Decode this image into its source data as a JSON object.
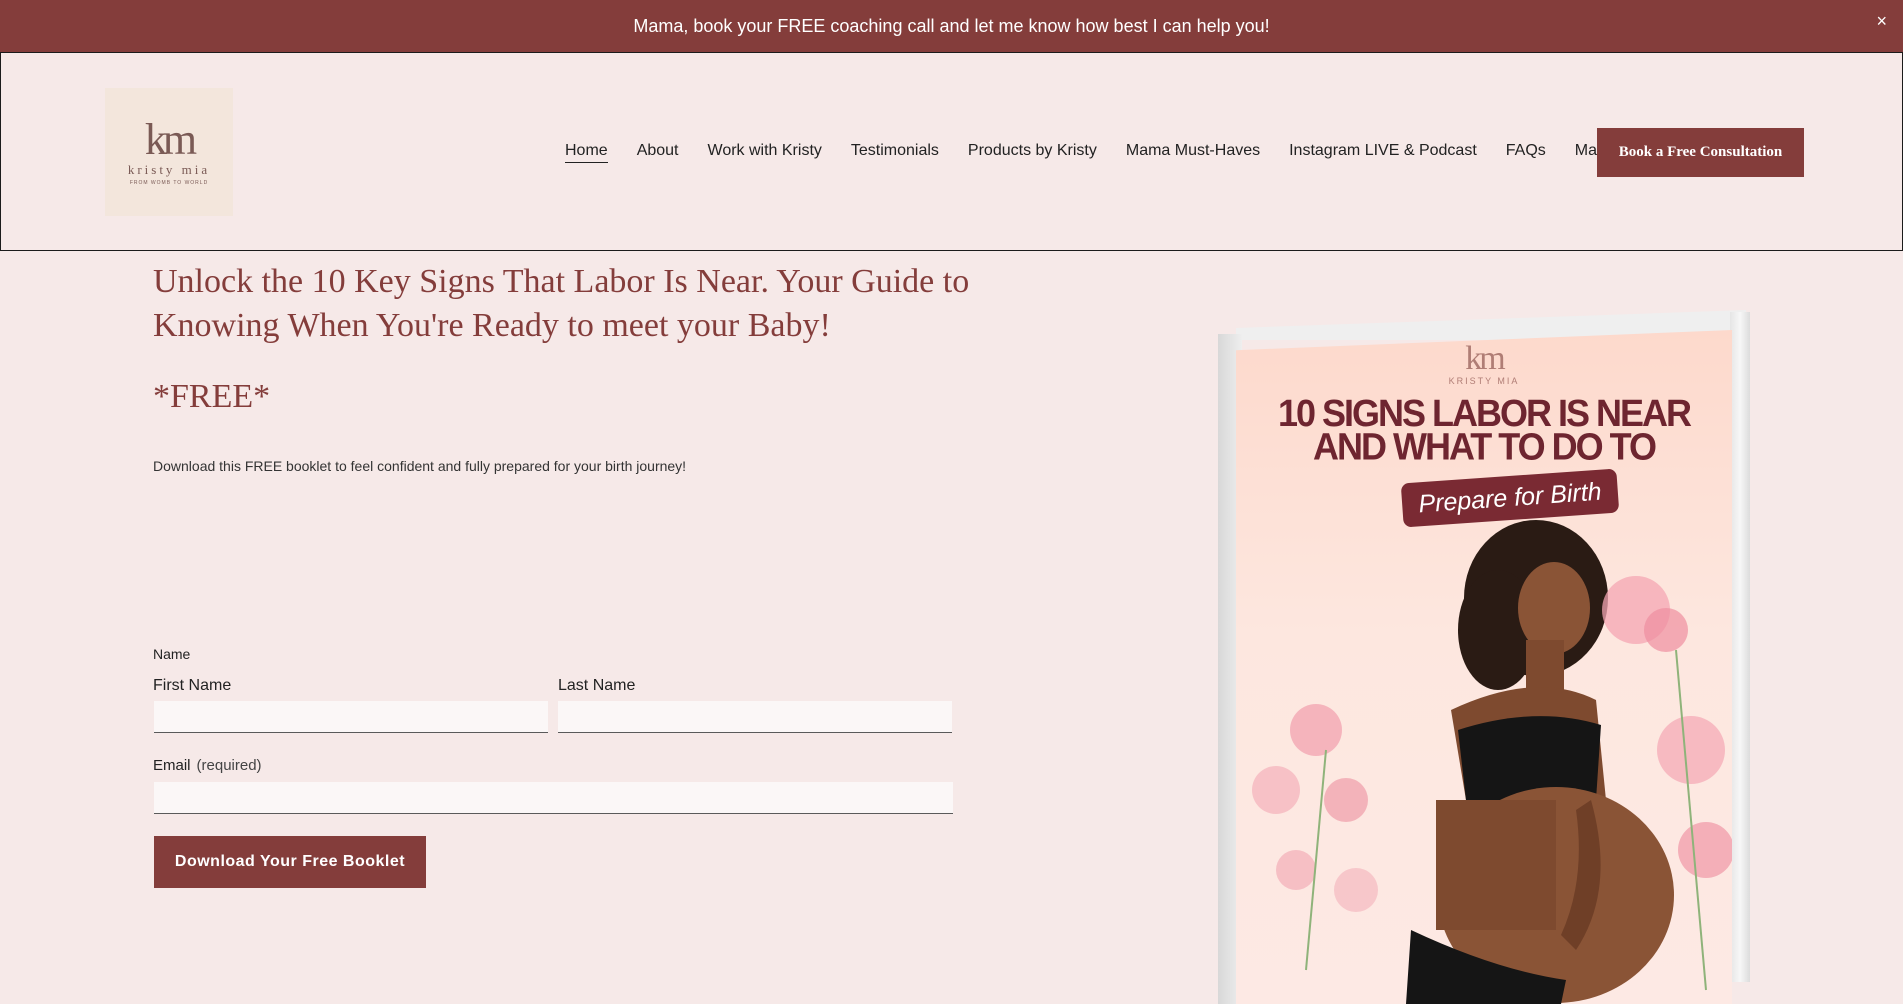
{
  "announcement": {
    "text": "Mama, book your FREE coaching call and let me know how best I can help you!",
    "close_glyph": "×"
  },
  "logo": {
    "monogram": "km",
    "name": "kristy mia",
    "tagline": "FROM WOMB TO WORLD"
  },
  "nav": {
    "items": [
      {
        "label": "Home",
        "active": true
      },
      {
        "label": "About"
      },
      {
        "label": "Work with Kristy"
      },
      {
        "label": "Testimonials"
      },
      {
        "label": "Products by Kristy"
      },
      {
        "label": "Mama Must-Haves"
      },
      {
        "label": "Instagram LIVE & Podcast"
      },
      {
        "label": "FAQs"
      },
      {
        "label": "Mama Blog"
      }
    ],
    "cta_label": "Book a Free Consultation"
  },
  "main": {
    "headline": "Unlock the 10 Key Signs That Labor Is Near. Your Guide to Knowing When You're Ready to meet your Baby!",
    "free_label": "*FREE*",
    "description": "Download this FREE booklet to feel confident and fully prepared for your birth journey!"
  },
  "form": {
    "name_label": "Name",
    "first_name_label": "First Name",
    "last_name_label": "Last Name",
    "email_label": "Email",
    "required_label": "(required)",
    "submit_label": "Download Your Free Booklet"
  },
  "booklet": {
    "logo_monogram": "km",
    "logo_name": "KRISTY MIA",
    "title_line1": "10 SIGNS LABOR IS NEAR",
    "title_line2": "AND WHAT TO DO TO",
    "pill": "Prepare for Birth"
  },
  "colors": {
    "brand": "#843d3b",
    "background": "#f6e9e8"
  }
}
